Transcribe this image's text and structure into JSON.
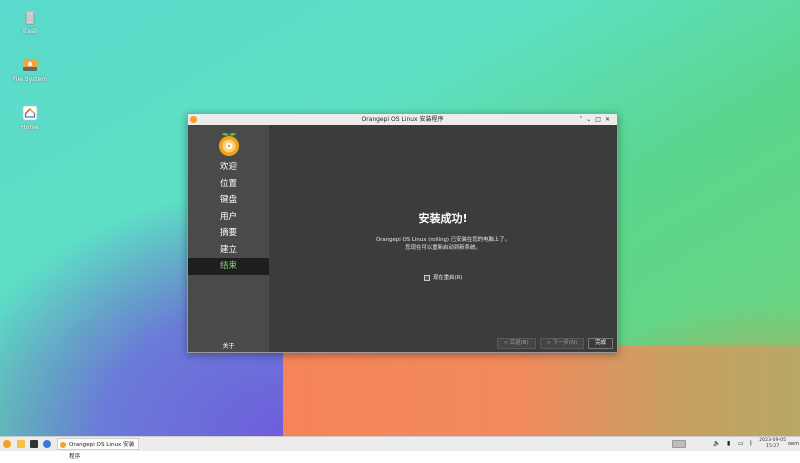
{
  "desktop": {
    "icons": [
      {
        "label": "Trash"
      },
      {
        "label": "File System"
      },
      {
        "label": "Home"
      }
    ]
  },
  "window": {
    "title": "Orangepi OS Linux 安装程序",
    "controls": {
      "minimize": "˄",
      "restore": "⌄",
      "maximize": "□",
      "close": "✕"
    }
  },
  "sidebar": {
    "steps": [
      "欢迎",
      "位置",
      "键盘",
      "用户",
      "摘要",
      "建立",
      "结束"
    ],
    "active_index": 6,
    "about": "关于"
  },
  "content": {
    "headline": "安装成功!",
    "message_line1": "Orangepi OS Linux (rolling) 已安装在您的电脑上了。",
    "message_line2": "您现在可以重新启动到新系统。",
    "reboot_label": "现在重启(R)",
    "reboot_checked": false
  },
  "buttons": {
    "back": "< 后退(B)",
    "next": "> 下一步(N)",
    "done": "完成"
  },
  "taskbar": {
    "task_label": "Orangepi OS Linux 安装程序",
    "date": "2023-09-05",
    "time": "15:27",
    "user": "oem"
  },
  "colors": {
    "accent_active": "#8ed36a",
    "window_bg": "#3c3c3c",
    "sidebar_bg": "#494b48",
    "logo_orange": "#f4a020",
    "logo_leaf": "#6cbf3a"
  }
}
